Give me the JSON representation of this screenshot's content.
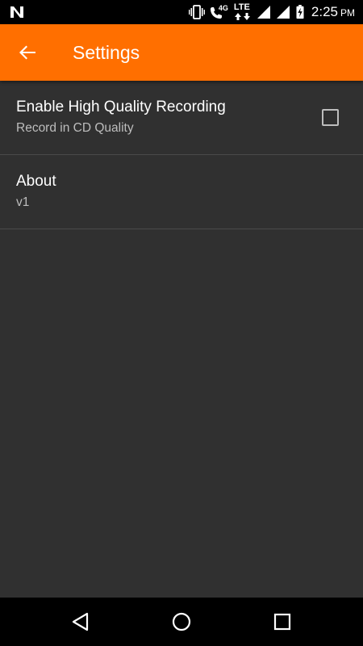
{
  "status_bar": {
    "time": "2:25",
    "ampm": "PM",
    "network_4g": "4G",
    "network_lte": "LTE",
    "icons": [
      "n-notification-icon",
      "vibrate-icon",
      "wifi-calling-icon",
      "lte-icon",
      "signal-icon",
      "signal-icon",
      "battery-charging-icon"
    ]
  },
  "app_bar": {
    "title": "Settings",
    "back_icon": "arrow-back-icon",
    "color": "#ff6f00"
  },
  "settings": [
    {
      "title": "Enable High Quality Recording",
      "summary": "Record in CD Quality",
      "checkbox": true,
      "checked": false
    },
    {
      "title": "About",
      "summary": "v1"
    }
  ],
  "nav_bar": {
    "buttons": [
      "back-triangle-icon",
      "home-circle-icon",
      "recents-square-icon"
    ]
  }
}
